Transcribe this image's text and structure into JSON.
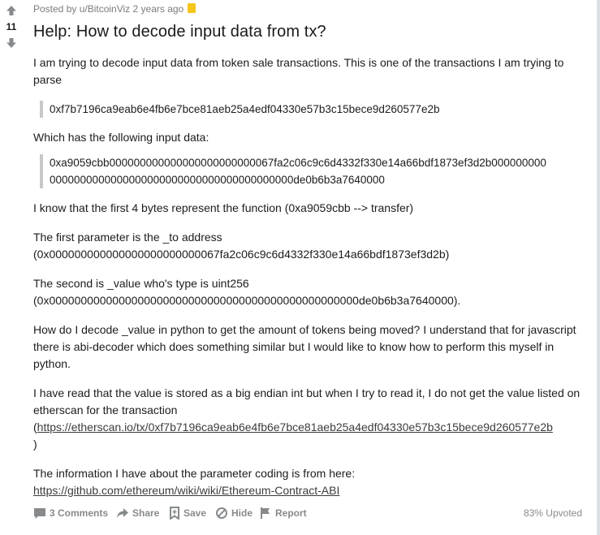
{
  "post": {
    "score": "11",
    "meta": "Posted by u/BitcoinViz 2 years ago",
    "title": "Help: How to decode input data from tx?",
    "body": {
      "p1": "I am trying to decode input data from token sale transactions. This is one of the transactions I am trying to parse",
      "quote1": "0xf7b7196ca9eab6e4fb6e7bce81aeb25a4edf04330e57b3c15bece9d260577e2b",
      "p2": "Which has the following input data:",
      "quote2_line1": "0xa9059cbb000000000000000000000000067fa2c06c9c6d4332f330e14a66bdf1873ef3d2b000000000",
      "quote2_line2": "0000000000000000000000000000000000000000de0b6b3a7640000",
      "p3": "I know that the first 4 bytes represent the function (0xa9059cbb --> transfer)",
      "p4_line1": "The first parameter is the _to address",
      "p4_line2": "(0x000000000000000000000000067fa2c06c9c6d4332f330e14a66bdf1873ef3d2b)",
      "p5_line1": "The second is _value who's type is uint256",
      "p5_line2": "(0x0000000000000000000000000000000000000000000000000de0b6b3a7640000).",
      "p6": "How do I decode _value in python to get the amount of tokens being moved? I understand that for javascript there is abi-decoder which does something similar but I would like to know how to perform this myself in python.",
      "p7": "I have read that the value is stored as a big endian int but when I try to read it, I do not get the value listed on etherscan for the transaction",
      "p7_open_paren": "(",
      "p7_link": "https://etherscan.io/tx/0xf7b7196ca9eab6e4fb6e7bce81aeb25a4edf04330e57b3c15bece9d260577e2b",
      "p7_close_paren": ")",
      "p8": "The information I have about the parameter coding is from here:",
      "p8_link": "https://github.com/ethereum/wiki/wiki/Ethereum-Contract-ABI"
    }
  },
  "actions": {
    "comments": "3 Comments",
    "share": "Share",
    "save": "Save",
    "hide": "Hide",
    "report": "Report",
    "upvoted": "83% Upvoted"
  },
  "icons": {
    "upvote": "arrow-up-icon",
    "downvote": "arrow-down-icon",
    "award": "award-icon",
    "comments": "comment-icon",
    "share": "share-icon",
    "save": "bookmark-icon",
    "hide": "hide-icon",
    "report": "flag-icon"
  },
  "colors": {
    "vote_arrow": "#878a8c",
    "award": "#f5c518",
    "quote_border": "#c8c8c8"
  }
}
